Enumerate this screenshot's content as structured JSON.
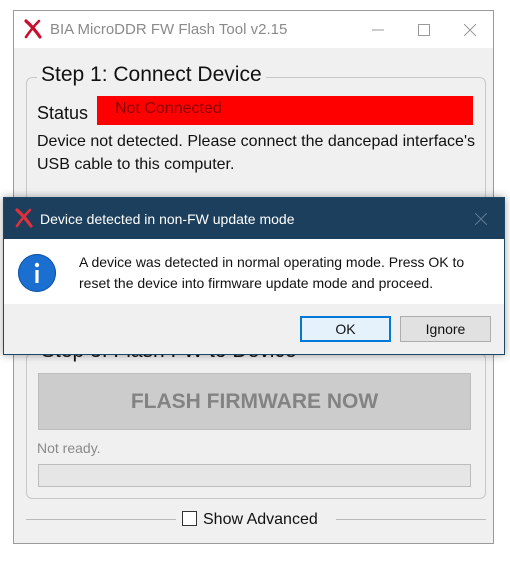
{
  "window": {
    "title": "BIA MicroDDR FW Flash Tool v2.15"
  },
  "step1": {
    "legend": "Step 1: Connect Device",
    "status_label": "Status",
    "status_value": "Not Connected",
    "message": "Device not detected. Please connect the dancepad interface's USB cable to this computer."
  },
  "step3": {
    "legend": "Step 3: Flash FW to Device",
    "flash_button": "FLASH FIRMWARE NOW",
    "status_text": "Not ready.",
    "progress": 0
  },
  "advanced": {
    "label": "Show Advanced",
    "checked": false
  },
  "dialog": {
    "title": "Device detected in non-FW update mode",
    "message": "A device was detected in normal operating mode. Press OK to reset the device into firmware update mode and proceed.",
    "ok_label": "OK",
    "ignore_label": "Ignore",
    "icon": "info-icon"
  },
  "colors": {
    "status_bg": "#ff0000",
    "dialog_titlebar": "#1b3f5c",
    "accent": "#0078d7",
    "info_icon": "#1a6fd1",
    "app_icon": "#c8102e"
  }
}
